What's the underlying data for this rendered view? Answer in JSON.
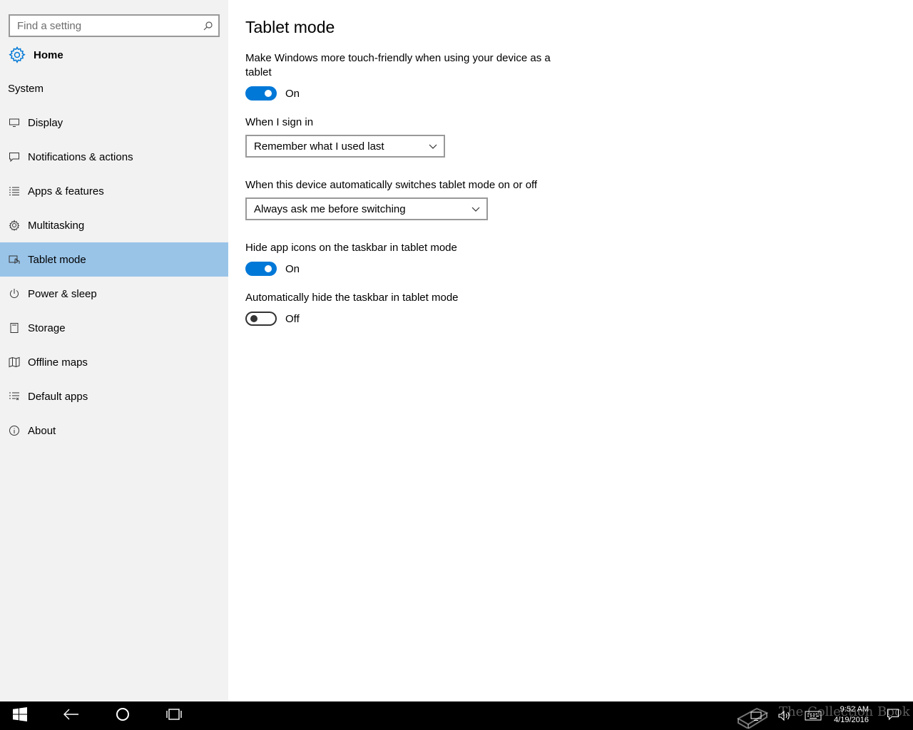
{
  "sidebar": {
    "search_placeholder": "Find a setting",
    "home_label": "Home",
    "section_title": "System",
    "items": [
      {
        "label": "Display",
        "icon": "monitor-icon"
      },
      {
        "label": "Notifications & actions",
        "icon": "message-icon"
      },
      {
        "label": "Apps & features",
        "icon": "list-icon"
      },
      {
        "label": "Multitasking",
        "icon": "multitasking-icon"
      },
      {
        "label": "Tablet mode",
        "icon": "tablet-mode-icon",
        "selected": true
      },
      {
        "label": "Power & sleep",
        "icon": "power-icon"
      },
      {
        "label": "Storage",
        "icon": "storage-icon"
      },
      {
        "label": "Offline maps",
        "icon": "map-icon"
      },
      {
        "label": "Default apps",
        "icon": "default-apps-icon"
      },
      {
        "label": "About",
        "icon": "info-icon"
      }
    ]
  },
  "main": {
    "title": "Tablet mode",
    "touch_friendly": {
      "label": "Make Windows more touch-friendly when using your device as a tablet",
      "state": "On"
    },
    "sign_in": {
      "label": "When I sign in",
      "value": "Remember what I used last"
    },
    "auto_switch": {
      "label": "When this device automatically switches tablet mode on or off",
      "value": "Always ask me before switching"
    },
    "hide_icons": {
      "label": "Hide app icons on the taskbar in tablet mode",
      "state": "On"
    },
    "auto_hide_taskbar": {
      "label": "Automatically hide the taskbar in tablet mode",
      "state": "Off"
    }
  },
  "taskbar": {
    "time": "9:52 AM",
    "date": "4/19/2016",
    "watermark": "The Collection Book"
  },
  "colors": {
    "accent": "#0078d7",
    "selected_bg": "#99c4e8",
    "sidebar_bg": "#f2f2f2"
  }
}
